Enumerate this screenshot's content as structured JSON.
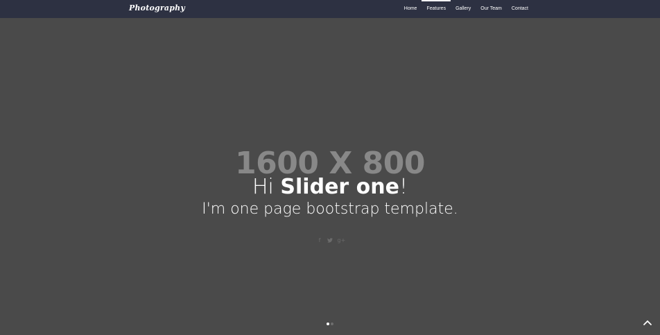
{
  "navbar": {
    "brand": "Photography",
    "items": [
      {
        "label": "Home",
        "active": false
      },
      {
        "label": "Features",
        "active": true
      },
      {
        "label": "Gallery",
        "active": false
      },
      {
        "label": "Our Team",
        "active": false
      },
      {
        "label": "Contact",
        "active": false
      }
    ]
  },
  "hero": {
    "placeholder_text": "1600 X 800",
    "title_prefix": "Hi ",
    "title_strong": "Slider one",
    "title_suffix": "!",
    "subtitle": "I'm one page bootstrap template.",
    "social_icons": [
      "facebook-icon",
      "twitter-icon",
      "google-plus-icon"
    ],
    "slide_count": 2,
    "active_slide": 1
  },
  "scroll_top": {
    "icon": "chevron-up-icon"
  }
}
